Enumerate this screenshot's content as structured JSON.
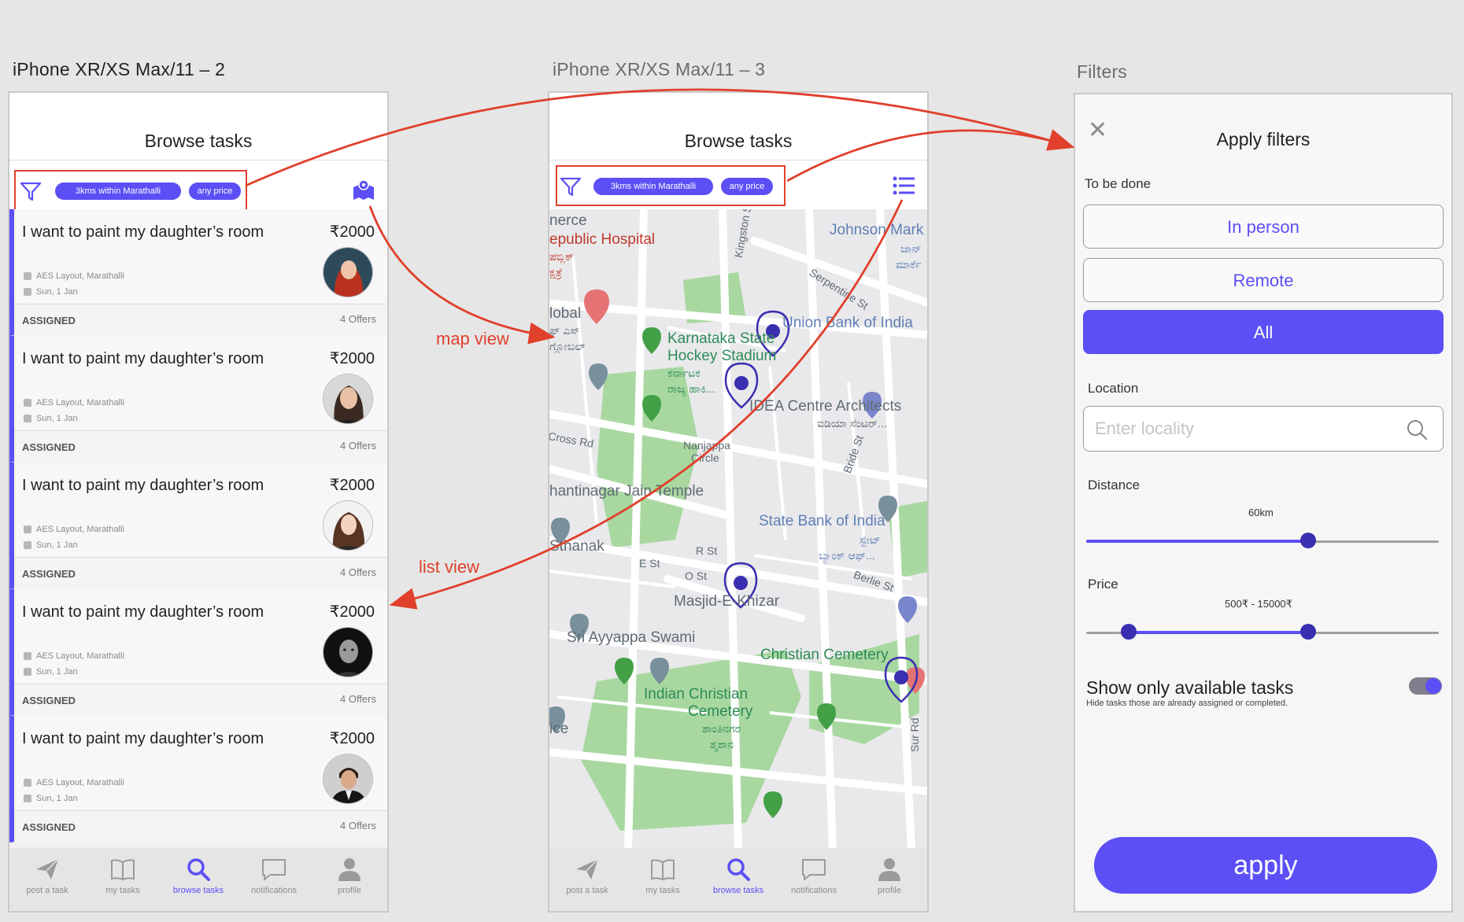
{
  "artboards": {
    "list_label": "iPhone XR/XS Max/11 – 2",
    "map_label": "iPhone XR/XS Max/11 – 3",
    "filters_label": "Filters"
  },
  "screen": {
    "title": "Browse tasks",
    "chip_location": "3kms within Marathalli",
    "chip_price": "any price"
  },
  "tasks": [
    {
      "title": "I want to paint my daughter’s room",
      "price": "₹2000",
      "location": "AES Layout, Marathalli",
      "date": "Sun, 1 Jan",
      "status": "ASSIGNED",
      "offers": "4 Offers"
    },
    {
      "title": "I want to paint my daughter’s room",
      "price": "₹2000",
      "location": "AES Layout, Marathalli",
      "date": "Sun, 1 Jan",
      "status": "ASSIGNED",
      "offers": "4 Offers"
    },
    {
      "title": "I want to paint my daughter’s room",
      "price": "₹2000",
      "location": "AES Layout, Marathalli",
      "date": "Sun, 1 Jan",
      "status": "ASSIGNED",
      "offers": "4 Offers"
    },
    {
      "title": "I want to paint my daughter’s room",
      "price": "₹2000",
      "location": "AES Layout, Marathalli",
      "date": "Sun, 1 Jan",
      "status": "ASSIGNED",
      "offers": "4 Offers"
    },
    {
      "title": "I want to paint my daughter’s room",
      "price": "₹2000",
      "location": "AES Layout, Marathalli",
      "date": "Sun, 1 Jan",
      "status": "ASSIGNED",
      "offers": "4 Offers"
    }
  ],
  "nav": [
    {
      "label": "post a task",
      "icon": "paper-plane-icon"
    },
    {
      "label": "my tasks",
      "icon": "book-icon"
    },
    {
      "label": "browse tasks",
      "icon": "search-icon"
    },
    {
      "label": "notifications",
      "icon": "chat-bubble-icon"
    },
    {
      "label": "profile",
      "icon": "person-icon"
    }
  ],
  "map_labels": {
    "commerce": "nerce",
    "republic_hospital": "epublic Hospital",
    "republic_kn": "ಪಬ್ಲಿಕ್",
    "republic_kn2": "ಕ್ಷತ್ರೆ",
    "johnson_market": "Johnson Mark",
    "johnson_kn1": "ಜಾನ್",
    "johnson_kn2": "ಮಾರ್ಕೆ",
    "kingston": "Kingston St",
    "serpentine": "Serpentine St",
    "global": "lobal",
    "global_kn1": "ಫ್ ಎಸ್",
    "global_kn2": "ಗ್ಲೋಬಲ್",
    "union_bank": "Union Bank of India",
    "karnataka1": "Karnataka State",
    "karnataka2": "Hockey Stadium",
    "karnataka_kn1": "ಕರ್ನಾಟಕ",
    "karnataka_kn2": "ರಾಜ್ಯ ಹಾಕಿ...",
    "idea1": "IDEA Centre Architects",
    "idea2": "ಐಡಿಯಾ ಸೆಂಟರ್...",
    "cross_rd": "Cross Rd",
    "nanjappa1": "Nanjappa",
    "nanjappa2": "Circle",
    "bride": "Bride St",
    "jain_temple": "hantinagar Jain Temple",
    "sbi": "State Bank of India",
    "sbi_kn1": "ಸ್ಟೇಟ್",
    "sbi_kn2": "ಬ್ಯಾಂಕ್ ಆಫ್...",
    "sthanak": "Sthanak",
    "e_st": "E St",
    "r_st": "R St",
    "o_st": "O St",
    "berlie": "Berlie St",
    "masjid": "Masjid-E-Khizar",
    "ayappa": "Sri Ayyappa Swami",
    "christian_cemetery": "Christian Cemetery",
    "indian_christian1": "Indian Christian",
    "indian_christian2": "Cemetery",
    "indian_kn1": "ಶಾಂತಿನಗರ",
    "indian_kn2": "ಶ್ಮಶಾನ",
    "ice": "ice",
    "sur_rd": "Sur Rd"
  },
  "filters": {
    "title": "Apply filters",
    "to_be_done_label": "To be done",
    "options": [
      "In person",
      "Remote",
      "All"
    ],
    "selected_option": "All",
    "location_label": "Location",
    "location_placeholder": "Enter locality",
    "distance_label": "Distance",
    "distance_value": "60km",
    "distance_fraction": 0.63,
    "price_label": "Price",
    "price_range": "500₹  - 15000₹",
    "price_low_fraction": 0.12,
    "price_high_fraction": 0.63,
    "available_title": "Show only available tasks",
    "available_sub": "Hide tasks those are already assigned or completed.",
    "available_on": true,
    "apply_label": "apply"
  },
  "annotations": {
    "map_view": "map view",
    "list_view": "list view"
  },
  "colors": {
    "accent": "#5b4ff5",
    "annotation": "#e0402c",
    "park": "#a8d8a0"
  }
}
